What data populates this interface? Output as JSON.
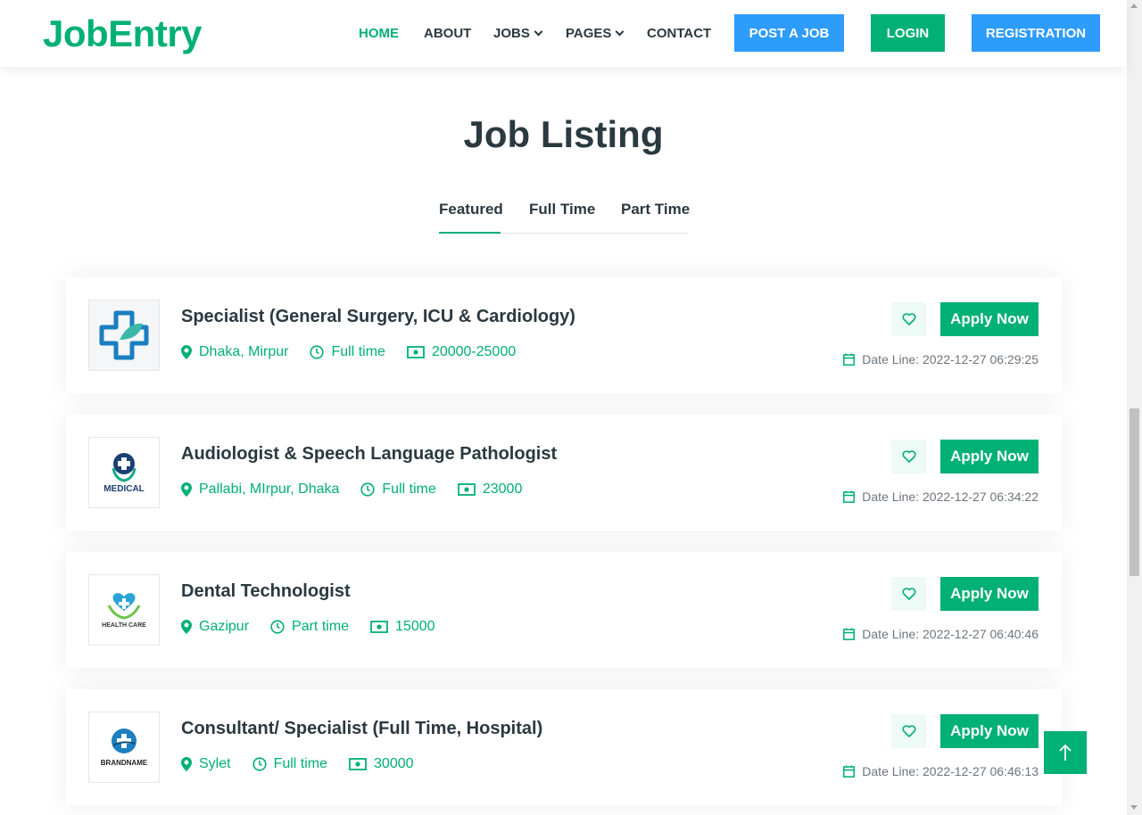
{
  "brand": {
    "name": "JobEntry",
    "color": "#00b074"
  },
  "nav": {
    "home": "HOME",
    "about": "ABOUT",
    "jobs": "JOBS",
    "pages": "PAGES",
    "contact": "CONTACT",
    "active": "HOME"
  },
  "header_buttons": {
    "post_job": "POST A JOB",
    "login": "LOGIN",
    "registration": "REGISTRATION"
  },
  "page_title": "Job Listing",
  "tabs": [
    {
      "label": "Featured",
      "active": true
    },
    {
      "label": "Full Time",
      "active": false
    },
    {
      "label": "Part Time",
      "active": false
    }
  ],
  "jobs": [
    {
      "title": "Specialist (General Surgery, ICU & Cardiology)",
      "location": "Dhaka, Mirpur",
      "type": "Full time",
      "salary": "20000-25000",
      "apply_label": "Apply Now",
      "date_line": "Date Line: 2022-12-27 06:29:25",
      "logo_icon": "medical-cross-logo"
    },
    {
      "title": "Audiologist & Speech Language Pathologist",
      "location": "Pallabi, MIrpur, Dhaka",
      "type": "Full time",
      "salary": "23000",
      "apply_label": "Apply Now",
      "date_line": "Date Line: 2022-12-27 06:34:22",
      "logo_icon": "medical-logo",
      "logo_text": "MEDICAL"
    },
    {
      "title": "Dental Technologist",
      "location": "Gazipur",
      "type": "Part time",
      "salary": "15000",
      "apply_label": "Apply Now",
      "date_line": "Date Line: 2022-12-27 06:40:46",
      "logo_icon": "health-care-logo",
      "logo_text": "HEALTH CARE"
    },
    {
      "title": "Consultant/ Specialist (Full Time, Hospital)",
      "location": "Sylet",
      "type": "Full time",
      "salary": "30000",
      "apply_label": "Apply Now",
      "date_line": "Date Line: 2022-12-27 06:46:13",
      "logo_icon": "brandname-logo",
      "logo_text": "BRANDNAME"
    }
  ],
  "colors": {
    "primary_green": "#00b074",
    "accent_blue": "#2d9cfa",
    "text_dark": "#2b3940"
  }
}
